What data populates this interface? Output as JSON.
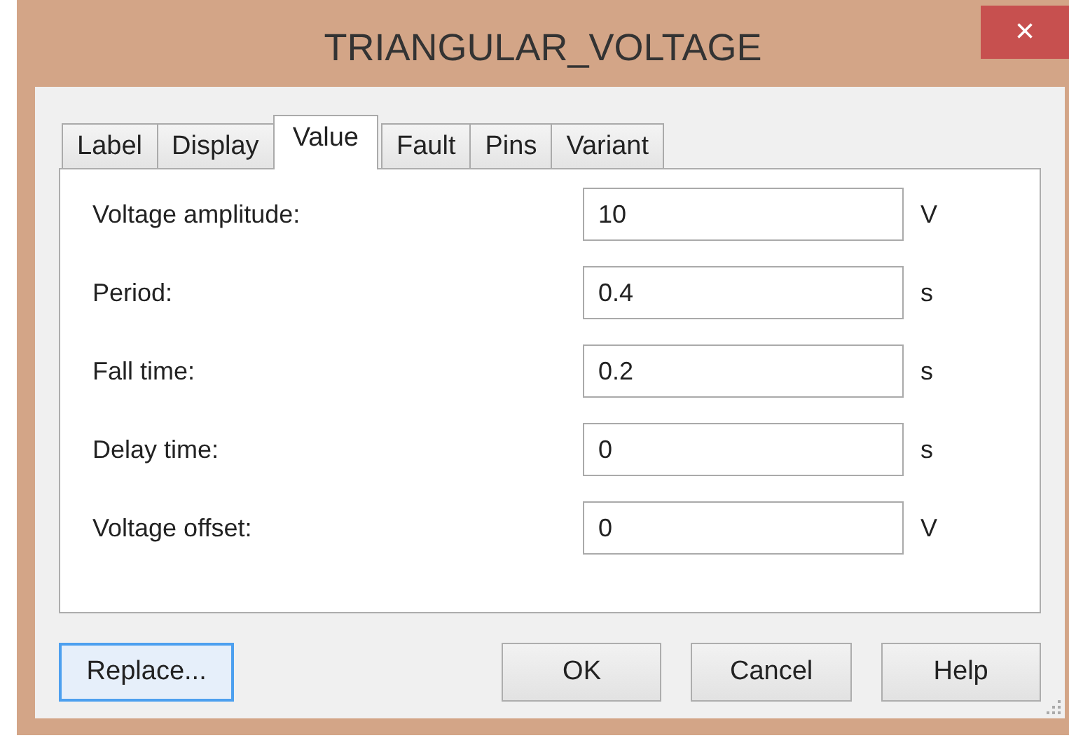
{
  "window": {
    "title": "TRIANGULAR_VOLTAGE",
    "close": "×"
  },
  "tabs": [
    {
      "label": "Label",
      "selected": false
    },
    {
      "label": "Display",
      "selected": false
    },
    {
      "label": "Value",
      "selected": true
    },
    {
      "label": "Fault",
      "selected": false
    },
    {
      "label": "Pins",
      "selected": false
    },
    {
      "label": "Variant",
      "selected": false
    }
  ],
  "fields": [
    {
      "label": "Voltage amplitude:",
      "value": "10",
      "unit": "V"
    },
    {
      "label": "Period:",
      "value": "0.4",
      "unit": "s"
    },
    {
      "label": "Fall time:",
      "value": "0.2",
      "unit": "s"
    },
    {
      "label": "Delay time:",
      "value": "0",
      "unit": "s"
    },
    {
      "label": "Voltage offset:",
      "value": "0",
      "unit": "V"
    }
  ],
  "buttons": [
    {
      "label": "Replace...",
      "focused": true
    },
    {
      "label": "OK",
      "focused": false
    },
    {
      "label": "Cancel",
      "focused": false
    },
    {
      "label": "Help",
      "focused": false
    }
  ]
}
